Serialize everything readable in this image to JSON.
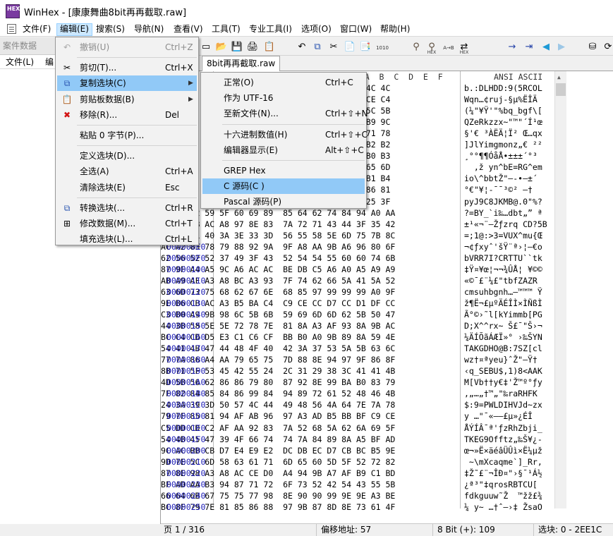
{
  "window": {
    "title": "WinHex - [康康舞曲8bit再再截取.raw]",
    "icon_text": "HEX"
  },
  "menubar": [
    {
      "label": "文件(F)",
      "name": "menu-file"
    },
    {
      "label": "编辑(E)",
      "name": "menu-edit"
    },
    {
      "label": "搜索(S)",
      "name": "menu-search"
    },
    {
      "label": "导航(N)",
      "name": "menu-navigate"
    },
    {
      "label": "查看(V)",
      "name": "menu-view"
    },
    {
      "label": "工具(T)",
      "name": "menu-tools"
    },
    {
      "label": "专业工具(I)",
      "name": "menu-specialist"
    },
    {
      "label": "选项(O)",
      "name": "menu-options"
    },
    {
      "label": "窗口(W)",
      "name": "menu-window"
    },
    {
      "label": "帮助(H)",
      "name": "menu-help"
    }
  ],
  "left_panel": {
    "title": "案件数据",
    "menu": [
      "文件(L)",
      "编"
    ]
  },
  "tab": {
    "label": "8bit再再截取.raw"
  },
  "toolbar_icons": [
    "new-file-icon",
    "open-file-icon",
    "save-icon",
    "print-icon",
    "properties-icon",
    "undo-icon",
    "copy-icon",
    "cut-icon",
    "paste-icon",
    "paste-special-icon",
    "binary-icon",
    "find-icon",
    "find-hex-icon",
    "replace-icon",
    "replace-hex-icon",
    "goto-offset-icon",
    "goto-sector-icon",
    "back-icon",
    "forward-icon",
    "disk-icon",
    "refresh-icon"
  ],
  "toolbar_small_text": {
    "hex1": "HEX",
    "ab": "A→B",
    "hex2": "HEX",
    "bin": "1010"
  },
  "edit_menu": [
    {
      "label": "撤销(U)",
      "key": "Ctrl+Z",
      "icon": "undo-icon",
      "disabled": true
    },
    {
      "sep": true
    },
    {
      "label": "剪切(T)...",
      "key": "Ctrl+X",
      "icon": "cut-icon"
    },
    {
      "label": "复制选块(C)",
      "key": "",
      "icon": "copy-block-icon",
      "submenu": true,
      "highlight": true
    },
    {
      "label": "剪贴板数据(B)",
      "key": "",
      "icon": "clipboard-icon",
      "submenu": true
    },
    {
      "label": "移除(R)...",
      "key": "Del",
      "icon": "remove-icon"
    },
    {
      "sep": true
    },
    {
      "label": "粘贴 0 字节(P)...",
      "key": ""
    },
    {
      "sep": true
    },
    {
      "label": "定义选块(D)...",
      "key": ""
    },
    {
      "label": "全选(A)",
      "key": "Ctrl+A"
    },
    {
      "label": "清除选块(E)",
      "key": "Esc"
    },
    {
      "sep": true
    },
    {
      "label": "转换选块(...",
      "key": "Ctrl+R",
      "icon": "convert-icon"
    },
    {
      "label": "修改数据(M)...",
      "key": "Ctrl+T",
      "icon": "modify-data-icon"
    },
    {
      "label": "填充选块(L)...",
      "key": "Ctrl+L"
    }
  ],
  "copy_submenu": [
    {
      "label": "正常(O)",
      "key": "Ctrl+C"
    },
    {
      "label": "作为 UTF-16",
      "key": ""
    },
    {
      "label": "至新文件(N)...",
      "key": "Ctrl+⇧+N"
    },
    {
      "sep": true
    },
    {
      "label": "十六进制数值(H)",
      "key": "Ctrl+⇧+C"
    },
    {
      "label": "编辑器显示(E)",
      "key": "Alt+⇧+C"
    },
    {
      "sep": true
    },
    {
      "label": "GREP Hex",
      "key": ""
    },
    {
      "label": "C 源码(C )",
      "key": "",
      "highlight": true
    },
    {
      "label": "Pascal 源码(P)",
      "key": ""
    }
  ],
  "hex_header": {
    "ascii_label": "ANSI ASCII"
  },
  "hex_header_cols": [
    "A",
    "B",
    "C",
    "D",
    "E",
    "F"
  ],
  "rows": [
    {
      "off": "",
      "hex": "                              28 35 52 4F 4C 4C",
      "ascii": "b.:DLHDD:9(5RCOL"
    },
    {
      "off": "",
      "hex": "                              5D 85 BE CB CE C4",
      "ascii": "Wqn…¢ruj-§µ%ËÎÄ"
    },
    {
      "off": "",
      "hex": "                              5F 62 67 66 5C 5B",
      "ascii": "(¼\"¥Ÿ'\"%bq_bgf\\["
    },
    {
      "off": "",
      "hex": "                              94 99 B4 CD B9 9C",
      "ascii": "QZeRkzzx~\"™\"´Í¹œ"
    },
    {
      "off": "",
      "hex": "                              B2 A0 8C 85 71 78",
      "ascii": "§'€ ³ÀËÄ¦Ï² Œ…qx"
    },
    {
      "off": "",
      "hex": "                              7A 84 80 A0 B2 B2",
      "ascii": "]JlYimgmonz„€ ²²"
    },
    {
      "off": "",
      "hex": "                              B1 B1 B1 B4 B0 B3",
      "ascii": "¸°°¶¶ÓåÅ•±±±´°³"
    },
    {
      "off": "",
      "hex": "                              3D 52 47 5E 65 6D",
      "ascii": "  ‚ž yn^bE=RG^em"
    },
    {
      "off": "",
      "hex": "                              97 97 95 96 B1 B4",
      "ascii": "io\\^bbtŽ\"—-•–±´"
    },
    {
      "off": "",
      "hex": "                              A9 B2 A0 96 86 81",
      "ascii": "°€\"¥¦-¯¯³©² –†"
    },
    {
      "off": "",
      "hex": "                              40 2E 30 22 25 3F",
      "ascii": "pyJ9C8JKMB@.0\"%?"
    },
    {
      "off": "",
      "hex": "3F 3D 42 59 5F 60 69 89  85 64 62 74 84 94 A0 AA",
      "ascii": "?=BY_`i‰…dbt„” ª"
    },
    {
      "off": "",
      "hex": "B1 B9 AB AC A8 97 8E 83  7A 72 71 43 44 3F 35 42",
      "ascii": "±¹«¬¨—Žƒzrq CD?5B"
    },
    {
      "off": "",
      "hex": "3D 3B 31 40 3A 3E 33 3D  56 55 58 5E 6D 75 7B 8C",
      "ascii": "=;1@:>3=VUX^mu{Œ"
    },
    {
      "off": "000000E0",
      "hex": "AC A2 83 78 79 88 92 9A  9F A8 AA 9B A6 96 80 6F",
      "ascii": "¬¢ƒxyˆ'šŸ¨ª›¦–€o"
    },
    {
      "off": "000000F0",
      "hex": "62 56 52 52 37 49 3F 43  52 54 54 55 60 60 74 6B",
      "ascii": "bVRR7I?CRTTU``tk"
    },
    {
      "off": "00000100",
      "hex": "87 9F A4 A5 9C A6 AC AC  BE DB C5 A6 A0 A5 A9 A9",
      "ascii": "‡Ÿ¤¥œ¦¬¬¾ÛÅ¦ ¥©©"
    },
    {
      "off": "00000110",
      "hex": "AB A9 AF A3 A8 BC A3 93  7F 74 62 66 5A 41 5A 52",
      "ascii": "«©¯£¨¼£\"tbfZAZR"
    },
    {
      "off": "00000120",
      "hex": "63 6D 73 75 68 62 67 6E  68 85 97 99 99 99 A0 9F",
      "ascii": "cmsuhbgnh…—™™™ Ÿ"
    },
    {
      "off": "00000130",
      "hex": "9E B6 CB AC A3 B5 BA C4  C9 CE CC D7 CC D1 DF CC",
      "ascii": "ž¶Ë¬£µºÄÉÎÌ×ÌÑßÌ"
    },
    {
      "off": "00000140",
      "hex": "C3 B0 A9 9B 98 6C 5B 6B  59 69 6D 6D 62 5B 50 47",
      "ascii": "Ã°©›˜l[kYimmb[PG"
    },
    {
      "off": "00000150",
      "hex": "44 3B 58 5E 5E 72 78 7E  81 8A A3 AF 93 8A 9B AC",
      "ascii": "D;X^^rx~ Š£¯\"Š›¬"
    },
    {
      "off": "00000160",
      "hex": "BC C4 CD D5 E3 C1 C6 CF  BB B0 A0 9B 89 8A 59 4E",
      "ascii": "¼ÄÍÕãÁÆÏ»° ›‰ŠYN"
    },
    {
      "off": "00000170",
      "hex": "54 41 4B 47 44 48 4F 40  42 3A 37 53 5A 5B 63 6C",
      "ascii": "TAKGDHO@B:7SZ[cl"
    },
    {
      "off": "00000180",
      "hex": "77 7A 86 A4 AA 79 65 75  7D 88 8E 94 97 9F 86 8F",
      "ascii": "wz†¤ªyeu}ˆŽ\"—Ÿ†"
    },
    {
      "off": "00000190",
      "hex": "8B 71 5F 53 45 42 55 24  2C 31 29 38 3C 41 41 4B",
      "ascii": "‹q_SEBU$,1)8<AAK"
    },
    {
      "off": "000001A0",
      "hex": "4D 5B 56 62 86 86 79 80  87 92 8E 99 BA B0 83 79",
      "ascii": "M[Vb††y€‡'Ž™º°ƒy"
    },
    {
      "off": "000001B0",
      "hex": "7F 82 84 85 84 86 99 84  94 89 72 61 52 48 46 4B",
      "ascii": "‚„…„†™„\"‰raRHFK"
    },
    {
      "off": "000001C0",
      "hex": "24 3A 39 3D 50 57 4C 44  49 48 56 4A 64 7E 7A 78",
      "ascii": "$:9=PWLDIHVJd~zx"
    },
    {
      "off": "000001D0",
      "hex": "79 7F 85 81 94 AF AB 96  97 A3 AD B5 BB BF C9 CE",
      "ascii": "y …\"¯«–—£­µ»¿ÉÎ"
    },
    {
      "off": "000001E0",
      "hex": "C5 DD CD C2 AF AA 92 83  7A 52 68 5A 62 6A 69 5F",
      "ascii": "ÅÝÍÂ¯ª'ƒzRhZbji_"
    },
    {
      "off": "000001F0",
      "hex": "54 4B 45 47 39 4F 66 74  74 7A 84 89 8A A5 BF AD",
      "ascii": "TKEG9Offtz„‰Š¥¿-"
    },
    {
      "off": "00000200",
      "hex": "9C AC BB CB D7 E4 E9 E2  DC DB EC D7 CB BC B5 9E",
      "ascii": "œ¬»Ë×äéâÜÛì×Ë¼µž"
    },
    {
      "off": "00000210",
      "hex": "9D 7E 5C 6D 58 63 61 71  6D 65 60 5D 5F 52 72 82",
      "ascii": " ~\\mXcaqme`]_Rr‚"
    },
    {
      "off": "00000220",
      "hex": "87 8E 98 A3 A8 AC CE D0  A4 94 9B A7 AF B9 C1 BD",
      "ascii": "‡Ž˜£¨¬ÎÐ¤\"›§¯¹Á½"
    },
    {
      "off": "00000230",
      "hex": "BF AD AA B3 94 87 71 72  6F 73 52 42 54 43 55 5B",
      "ascii": "¿­ª³\"‡qrosRBTCU["
    },
    {
      "off": "00000240",
      "hex": "66 64 6B 67 75 75 77 98  8E 90 90 99 9E 9E A3 BE",
      "ascii": "fdkguuw˜Ž  ™žž£¾"
    },
    {
      "off": "00000250",
      "hex": "BC 8F 79 7E 81 85 86 88  97 9B 87 8D 8E 73 61 4F",
      "ascii": "¼ y~ …†ˆ—›‡ ŽsaO"
    }
  ],
  "status": [
    {
      "label": "页 1 / 316"
    },
    {
      "label": "偏移地址: 57"
    },
    {
      "label": "8 Bit (+): 109"
    },
    {
      "label": "选块: 0 - 2EE1C"
    }
  ],
  "colors": {
    "offset": "#1a1ab4",
    "highlight": "#91c9f7",
    "menu_active": "#cce8ff"
  }
}
